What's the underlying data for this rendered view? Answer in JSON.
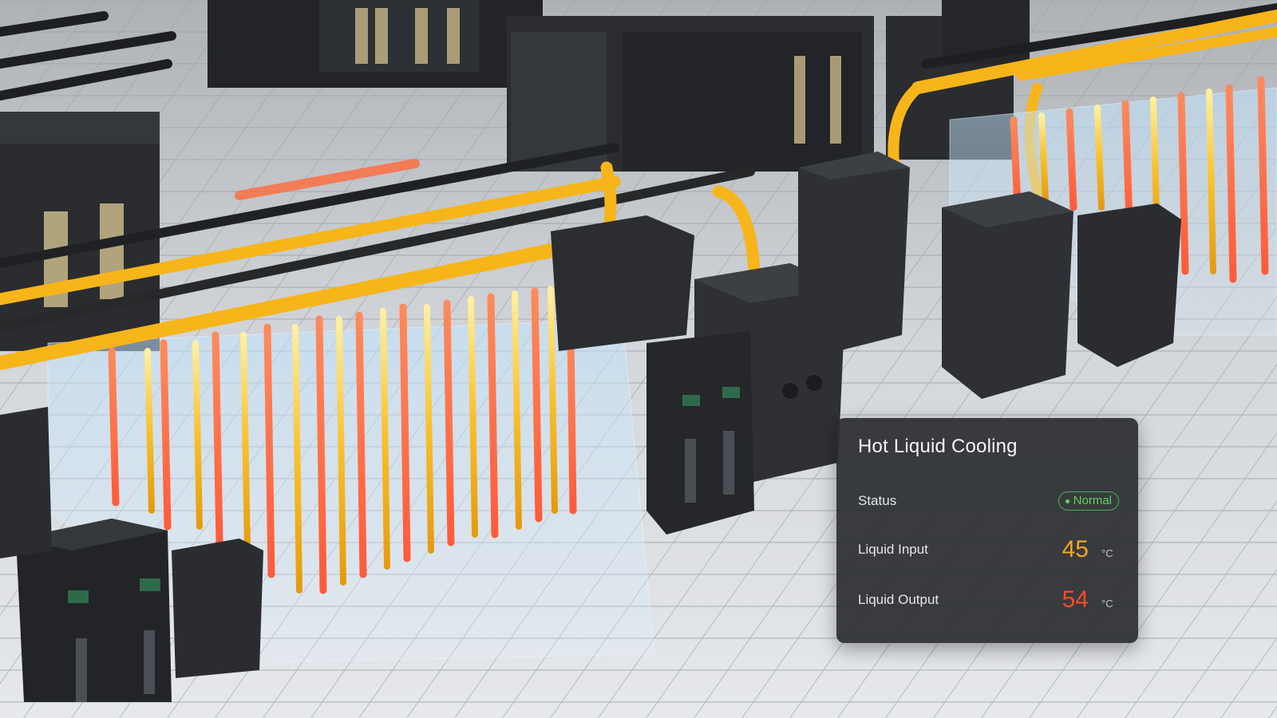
{
  "scene": {
    "description_icon": "data-center-liquid-cooling-render"
  },
  "panel": {
    "title": "Hot Liquid Cooling",
    "status": {
      "label": "Status",
      "value": "Normal",
      "color": "#5fd35f"
    },
    "liquid_input": {
      "label": "Liquid Input",
      "value": "45",
      "unit": "°C",
      "color": "#f5a623"
    },
    "liquid_output": {
      "label": "Liquid Output",
      "value": "54",
      "unit": "°C",
      "color": "#ff4b2b"
    }
  }
}
